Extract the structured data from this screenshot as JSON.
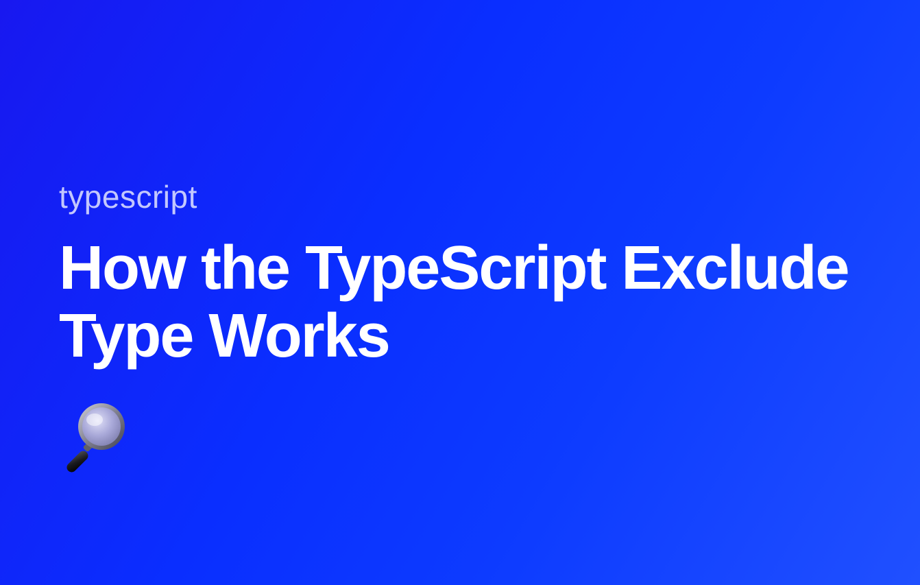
{
  "category": "typescript",
  "title": "How the TypeScript Exclude Type Works",
  "icon": "magnifying-glass"
}
